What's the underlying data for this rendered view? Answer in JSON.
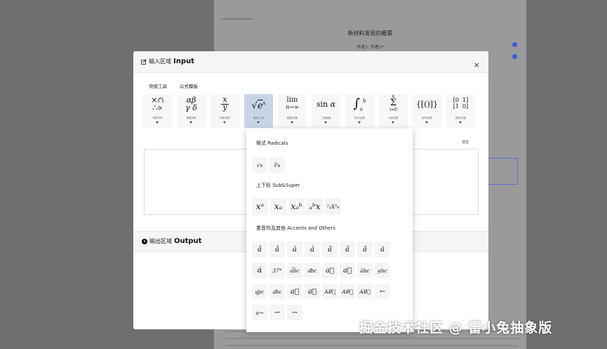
{
  "background": {
    "doc_title": "新材料发现的概票",
    "doc_authors": "作者1,        作者2*"
  },
  "modal": {
    "input_title_cn": "输入区域",
    "input_title_en": "Input",
    "close_label": "×",
    "tabs": [
      "快捷工具",
      "公式模板"
    ],
    "templates": [
      {
        "glyph": "×∩ ∴∝",
        "caption": "常用符号"
      },
      {
        "glyph": "αβ γδ",
        "caption": "希腊字母"
      },
      {
        "glyph": "x⁄y",
        "caption": "分数/根式"
      },
      {
        "glyph": "√eˣ",
        "caption": "根式/上标"
      },
      {
        "glyph": "lim n→∞",
        "caption": "极限/对数"
      },
      {
        "glyph": "sin α",
        "caption": "三角函数"
      },
      {
        "glyph": "∫ₐᵇ",
        "caption": "积分/运算"
      },
      {
        "glyph": "Σ",
        "caption": "大型运算"
      },
      {
        "glyph": "{[()]}",
        "caption": "括号/矩阵"
      },
      {
        "glyph": "[0 1; 1 0]",
        "caption": "矩阵/向量"
      }
    ],
    "active_template": 3,
    "clear_label": "清空",
    "output_title_cn": "输出区域",
    "output_title_en": "Output"
  },
  "dropdown": {
    "sections": [
      {
        "title": "根式 Radicals",
        "symbols": [
          "√x",
          "∛x"
        ]
      },
      {
        "title": "上下标 Sub&Super",
        "symbols": [
          "xᵃ",
          "xₐ",
          "xₐᵇ",
          "ₐᵇx",
          "²₁X³₄"
        ]
      },
      {
        "title": "重音符及其他 Accents and Others",
        "symbols": [
          "â",
          "ǎ",
          "à",
          "á",
          "ã",
          "ă",
          "ā",
          "ȧ",
          "ά",
          "37°",
          "a͡bc",
          "a͝bc",
          "a⃖",
          "a⃗",
          "a̅bc",
          "a̲bc",
          "a͜bc",
          "a͞bc",
          "a⃡",
          "a⃐",
          "AB⃖",
          "AB⃗",
          "AB⃡",
          "←",
          "a→",
          "⇀",
          "⇁"
        ]
      }
    ]
  },
  "watermark": "掘金技术社区 @ 雷小兔抽象版"
}
